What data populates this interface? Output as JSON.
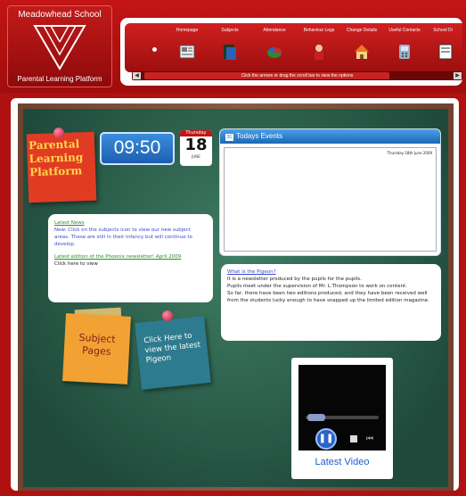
{
  "header": {
    "school_name": "Meadowhead School",
    "platform_name": "Parental Learning Platform"
  },
  "nav": {
    "items": [
      {
        "label": "",
        "icon": "dot-icon"
      },
      {
        "label": "Homepage",
        "icon": "newspaper-icon"
      },
      {
        "label": "Subjects",
        "icon": "books-icon"
      },
      {
        "label": "Attendance",
        "icon": "pie-chart-icon"
      },
      {
        "label": "Behaviour Logs",
        "icon": "person-icon"
      },
      {
        "label": "Change Details",
        "icon": "house-icon"
      },
      {
        "label": "Useful Contacts",
        "icon": "phone-icon"
      },
      {
        "label": "School Di",
        "icon": "document-icon"
      }
    ],
    "scroll_hint": "Click the arrows or drag the scroll bar to view the options"
  },
  "board": {
    "plp_note": "Parental Learning Platform",
    "clock": "09:50",
    "date_day": "Thursday",
    "date_num": "18",
    "date_month": "JUNE",
    "events_title": "Todays Events",
    "events_date": "Thursday 18th June 2009"
  },
  "news": {
    "heading": "Latest News",
    "body": "New: Click on the subjects icon to view our new subject areas. These are still in their infancy but will continue to develop.",
    "newsletter_link": "Latest edition of the Phoenix newsletter! April 2009",
    "newsletter_text": "Click here to view"
  },
  "pigeon": {
    "heading": "What is the Pigeon?",
    "line1": "It is a newsletter produced by the pupils for the pupils.",
    "line2": "Pupils meet under the supervision of Mr. L Thompson to work on content.",
    "line3": "So far, there have been two editions produced, and they have been received well from the students lucky enough to have snapped up the limited edition magazine."
  },
  "notes": {
    "subject_pages": "Subject Pages",
    "latest_pigeon": "Click Here to view the latest Pigeon"
  },
  "video": {
    "label": "Latest Video"
  },
  "colors": {
    "brand_red": "#b01010",
    "chalkboard_green": "#2f6650",
    "clock_blue": "#2a73c9"
  }
}
